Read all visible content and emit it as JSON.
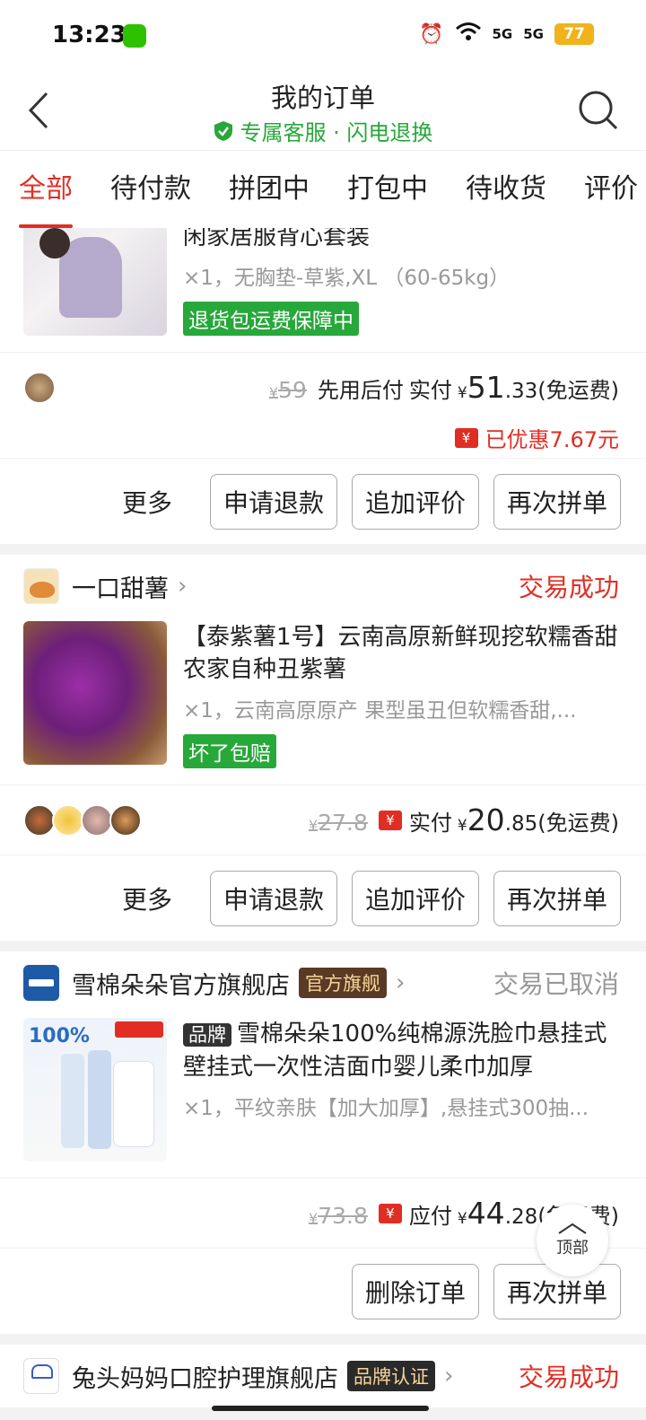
{
  "status_bar": {
    "time": "13:23",
    "signal1": "5G",
    "signal2": "5G",
    "battery": "77"
  },
  "header": {
    "title": "我的订单",
    "subtitle": "专属客服 · 闪电退换"
  },
  "tabs": [
    "全部",
    "待付款",
    "拼团中",
    "打包中",
    "待收货",
    "评价"
  ],
  "orders": [
    {
      "product_name": "闲家居服背心套装",
      "spec": "×1，无胸垫-草紫,XL （60-65kg）",
      "guarantee_tag": "退货包运费保障中",
      "original_price": "59",
      "pay_prefix": "先用后付",
      "pay_label": "实付",
      "price_int": "51",
      "price_dec": ".33",
      "shipping": "(免运费)",
      "discount": "已优惠7.67元",
      "more": "更多",
      "buttons": [
        "申请退款",
        "追加评价",
        "再次拼单"
      ]
    },
    {
      "shop_name": "一口甜薯",
      "status": "交易成功",
      "product_name": "【泰紫薯1号】云南高原新鲜现挖软糯香甜 农家自种丑紫薯",
      "spec": "×1，云南高原原产 果型虽丑但软糯香甜,...",
      "guarantee_tag": "坏了包赔",
      "original_price": "27.8",
      "pay_label": "实付",
      "price_int": "20",
      "price_dec": ".85",
      "shipping": "(免运费)",
      "more": "更多",
      "buttons": [
        "申请退款",
        "追加评价",
        "再次拼单"
      ]
    },
    {
      "shop_name": "雪棉朵朵官方旗舰店",
      "shop_badge": "官方旗舰",
      "status": "交易已取消",
      "brand_tag": "品牌",
      "product_name": "雪棉朵朵100%纯棉源洗脸巾悬挂式壁挂式一次性洁面巾婴儿柔巾加厚",
      "spec": "×1，平纹亲肤【加大加厚】,悬挂式300抽...",
      "original_price": "73.8",
      "pay_label": "应付",
      "price_int": "44",
      "price_dec": ".28",
      "shipping": "(免运费)",
      "buttons": [
        "删除订单",
        "再次拼单"
      ]
    },
    {
      "shop_name": "兔头妈妈口腔护理旗舰店",
      "shop_badge": "品牌认证",
      "status": "交易成功"
    }
  ],
  "float_button": "顶部",
  "colors": {
    "accent": "#e02e24",
    "green": "#27a83a",
    "cancelled": "#999999"
  }
}
